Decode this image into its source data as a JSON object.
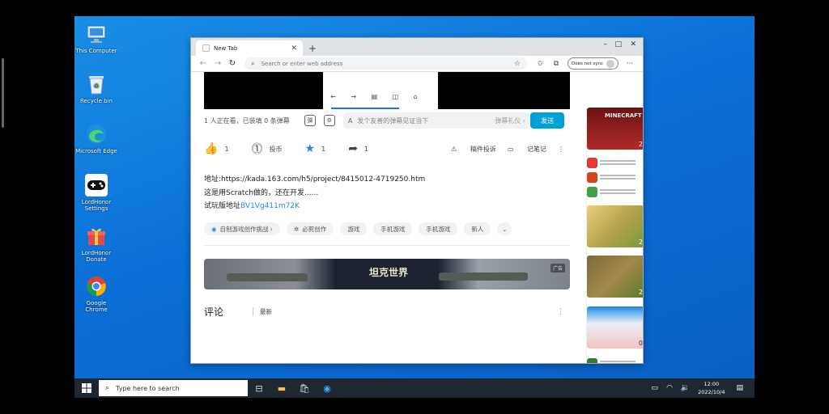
{
  "desktop": {
    "icons": [
      {
        "label": "This Computer",
        "icon": "computer-icon"
      },
      {
        "label": "Recycle bin",
        "icon": "recycle-bin-icon"
      },
      {
        "label": "Microsoft Edge",
        "icon": "edge-icon"
      },
      {
        "label": "LordHonor Settings",
        "icon": "gamepad-icon"
      },
      {
        "label": "LordHonor Donate",
        "icon": "gift-icon"
      },
      {
        "label": "Google Chrome",
        "icon": "chrome-icon"
      }
    ]
  },
  "browser": {
    "tab_title": "New Tab",
    "address_placeholder": "Search or enter web address",
    "profile_label": "Does not sync",
    "window_controls": {
      "minimize": "–",
      "maximize": "□",
      "close": "✕"
    }
  },
  "player": {
    "viewer_text": "1 人正在看，已装填 0 条弹幕",
    "danmu_prefix": "A",
    "danmu_placeholder": "发个友善的弹幕见证当下",
    "danmu_etiquette": "弹幕礼仪 ›",
    "send_label": "发送"
  },
  "actions": {
    "like_count": "1",
    "coin_label": "投币",
    "fav_count": "1",
    "share_count": "1",
    "report_label": "稿件投诉",
    "note_label": "记笔记"
  },
  "description": {
    "line1": "地址:https://kada.163.com/h5/project/8415012-4719250.htm",
    "line2": "这是用Scratch做的，还在开发......",
    "line3_prefix": "试玩版地址",
    "line3_link": "BV1Vg411m72K"
  },
  "tags": [
    "自制游戏创作挑战 ›",
    "必剪创作",
    "游戏",
    "手机游戏",
    "手机游戏",
    "新人"
  ],
  "ad": {
    "title": "坦克世界",
    "badge": "广告"
  },
  "comments": {
    "title": "评论",
    "sort_label": "最新"
  },
  "feed": {
    "counts": [
      "2",
      "2",
      "2",
      "0"
    ],
    "minecraft_label": "MINECRAFT"
  },
  "taskbar": {
    "search_placeholder": "Type here to search",
    "time": "12:00",
    "date": "2022/10/4"
  },
  "colors": {
    "accent": "#00a1d6",
    "link": "#1e88e5",
    "taskbar": "#1f2733"
  }
}
